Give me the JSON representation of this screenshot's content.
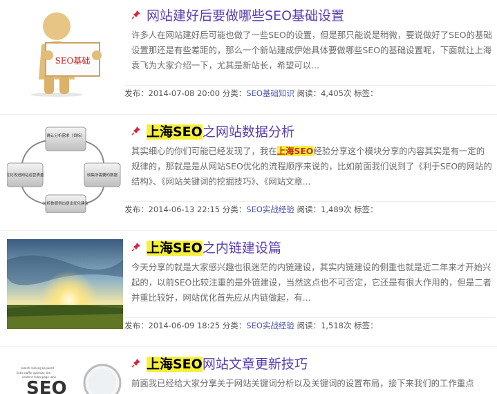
{
  "posts": [
    {
      "title": "网站建好后要做哪些SEO基础设置",
      "title_hl": "",
      "excerpt_pre": "许多人在网站建好后可能也做了一些SEO的设置，但是那只能说是稍微，要说做好了SEO的基础设置那还是有些差距的，那么一个新站建成伊始具体要做哪些SEO的基础设置呢，下面就让上海袁飞为大家介绍一下，尤其是新站长，希望可以...",
      "excerpt_hl": "",
      "excerpt_post": "",
      "meta_prefix": "发布：2014-07-08 20:00 分类：",
      "category": "SEO基础知识",
      "meta_suffix": " 阅读：4,405次 标签：",
      "thumb_text": "SEO基础"
    },
    {
      "title": "之网站数据分析",
      "title_hl": "上海SEO",
      "excerpt_pre": "其实细心的你们可能已经发现了，我在",
      "excerpt_hl": "上海SEO",
      "excerpt_post": "经验分享这个模块分享的内容其实是有一定的规律的，那就是是从网站SEO优化的流程顺序来说的，比如前面我们说到了《利于SEO的网站的结构》、《网站关键词的挖掘技巧》、《网站文章...",
      "meta_prefix": "发布：2014-06-13 22:15 分类：",
      "category": "SEO实战经验",
      "meta_suffix": " 阅读：1,489次 标签：",
      "thumb_nodes": [
        "确认分析需求（目标）",
        "收集所需要的数据",
        "分析数据得出提出优化建议",
        "优化改进网站运营质量"
      ]
    },
    {
      "title": "之内链建设篇",
      "title_hl": "上海SEO",
      "excerpt_pre": "今天分享的就是大家感兴趣也很迷茫的内链建设，其实内链建设的侧重也就是近二年来才开始兴起的，以前SEO比较注重的是外链建设，当然这点也不可否定，它还是有很大作用的，但是二者并重比较好，网站优化首先应从内链做起，有...",
      "excerpt_hl": "",
      "excerpt_post": "",
      "meta_prefix": "发布：2014-06-09 18:25 分类：",
      "category": "SEO实战经验",
      "meta_suffix": " 阅读：1,518次 标签：",
      "thumb_text": ""
    },
    {
      "title": "网站文章更新技巧",
      "title_hl": "上海SEO",
      "excerpt_pre": "前面我已经给大家分享关于网站关键词分析以及关键词的设置布局，接下来我们的工作重点",
      "excerpt_hl": "",
      "excerpt_post": "",
      "meta_prefix": "",
      "category": "",
      "meta_suffix": "",
      "thumb_text": "SEO"
    }
  ],
  "colors": {
    "title": "#5a3fb0",
    "highlight": "#f6f03a",
    "pin": "#d8253f",
    "link": "#4a55a6"
  },
  "icons": {
    "pin": "pushpin-icon"
  }
}
